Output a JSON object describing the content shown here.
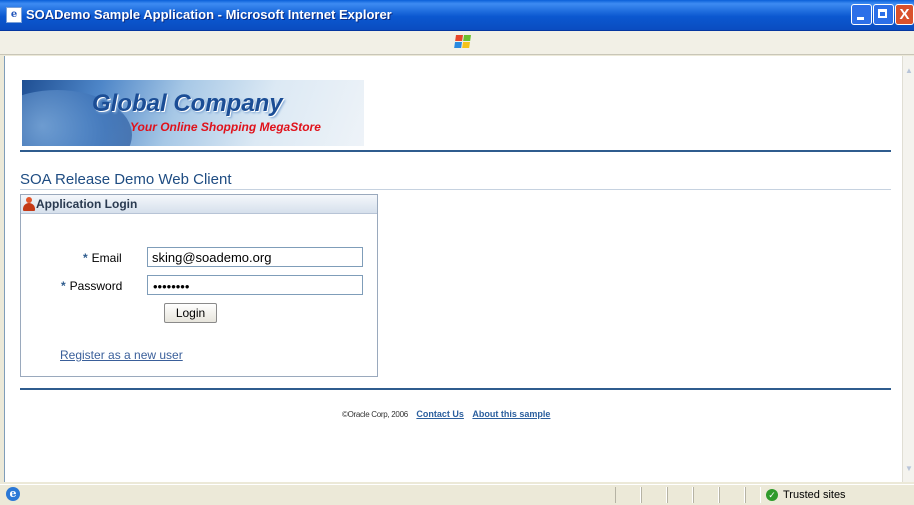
{
  "window": {
    "title": "SOADemo Sample Application - Microsoft Internet Explorer",
    "close_glyph": "X"
  },
  "banner": {
    "brand": "Global Company",
    "tagline": "Your Online Shopping MegaStore"
  },
  "page": {
    "title": "SOA Release Demo Web Client"
  },
  "login_panel": {
    "title": "Application Login",
    "required_marker": "*",
    "email_label": "Email",
    "email_value": "sking@soademo.org",
    "password_label": "Password",
    "password_masked": "••••••••",
    "login_button": "Login",
    "register_link": "Register as a new user"
  },
  "footer": {
    "copyright": "©Oracle Corp, 2006",
    "contact_link": "Contact Us",
    "about_link": "About this sample"
  },
  "statusbar": {
    "zone": "Trusted sites"
  },
  "colors": {
    "title_bar": "#0b58d0",
    "heading": "#1e4c82",
    "rule": "#2f5c8e",
    "link": "#2b5f9e",
    "tagline": "#e0121b"
  }
}
